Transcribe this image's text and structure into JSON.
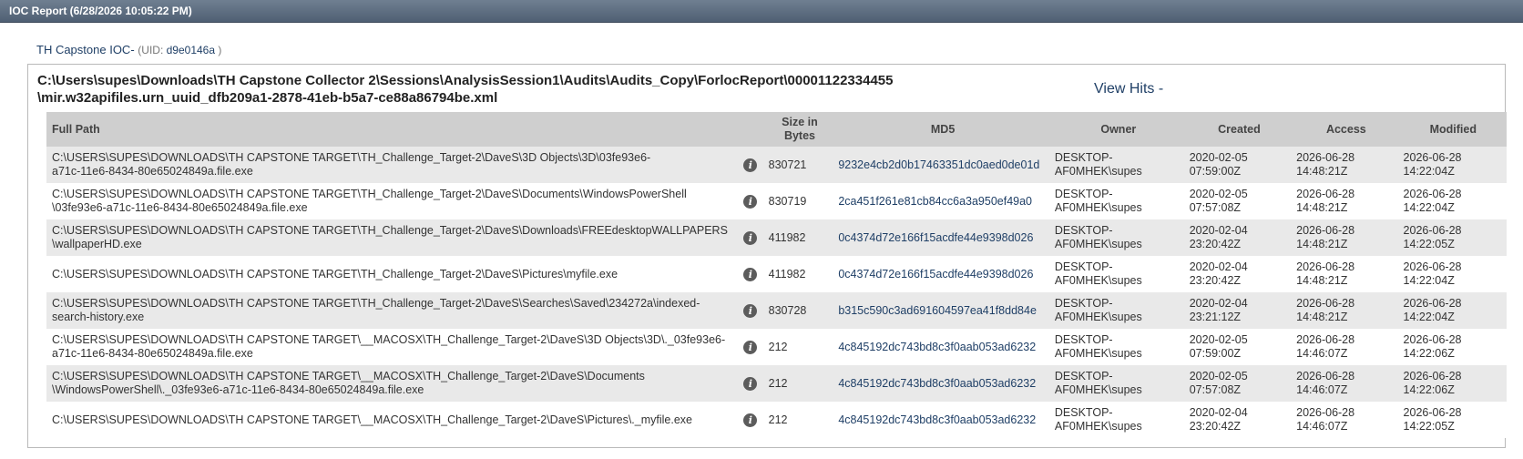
{
  "window": {
    "title": "IOC Report (6/28/2026 10:05:22 PM)"
  },
  "ioc": {
    "name": "TH Capstone IOC-",
    "uid_label": "(UID:",
    "uid": "d9e0146a",
    "uid_close": ")"
  },
  "panel": {
    "path_line1": "C:\\Users\\supes\\Downloads\\TH Capstone Collector 2\\Sessions\\AnalysisSession1\\Audits\\Audits_Copy\\ForlocReport\\00001122334455",
    "path_line2": "\\mir.w32apifiles.urn_uuid_dfb209a1-2878-41eb-b5a7-ce88a86794be.xml",
    "view_hits": "View Hits -"
  },
  "table": {
    "headers": {
      "full_path": "Full Path",
      "size_line1": "Size in",
      "size_line2": "Bytes",
      "md5": "MD5",
      "owner": "Owner",
      "created": "Created",
      "access": "Access",
      "modified": "Modified"
    },
    "rows": [
      {
        "path1": "C:\\USERS\\SUPES\\DOWNLOADS\\TH CAPSTONE TARGET\\TH_Challenge_Target-2\\DaveS\\3D Objects\\3D\\03fe93e6-",
        "path2": "a71c-11e6-8434-80e65024849a.file.exe",
        "size": "830721",
        "md5": "9232e4cb2d0b17463351dc0aed0de01d",
        "owner1": "DESKTOP-",
        "owner2": "AF0MHEK\\supes",
        "created1": "2020-02-05",
        "created2": "07:59:00Z",
        "access1": "2026-06-28",
        "access2": "14:48:21Z",
        "modified1": "2026-06-28",
        "modified2": "14:22:04Z"
      },
      {
        "path1": "C:\\USERS\\SUPES\\DOWNLOADS\\TH CAPSTONE TARGET\\TH_Challenge_Target-2\\DaveS\\Documents\\WindowsPowerShell",
        "path2": "\\03fe93e6-a71c-11e6-8434-80e65024849a.file.exe",
        "size": "830719",
        "md5": "2ca451f261e81cb84cc6a3a950ef49a0",
        "owner1": "DESKTOP-",
        "owner2": "AF0MHEK\\supes",
        "created1": "2020-02-05",
        "created2": "07:57:08Z",
        "access1": "2026-06-28",
        "access2": "14:48:21Z",
        "modified1": "2026-06-28",
        "modified2": "14:22:04Z"
      },
      {
        "path1": "C:\\USERS\\SUPES\\DOWNLOADS\\TH CAPSTONE TARGET\\TH_Challenge_Target-2\\DaveS\\Downloads\\FREEdesktopWALLPAPERS",
        "path2": "\\wallpaperHD.exe",
        "size": "411982",
        "md5": "0c4374d72e166f15acdfe44e9398d026",
        "owner1": "DESKTOP-",
        "owner2": "AF0MHEK\\supes",
        "created1": "2020-02-04",
        "created2": "23:20:42Z",
        "access1": "2026-06-28",
        "access2": "14:48:21Z",
        "modified1": "2026-06-28",
        "modified2": "14:22:05Z"
      },
      {
        "path1": "C:\\USERS\\SUPES\\DOWNLOADS\\TH CAPSTONE TARGET\\TH_Challenge_Target-2\\DaveS\\Pictures\\myfile.exe",
        "path2": "",
        "size": "411982",
        "md5": "0c4374d72e166f15acdfe44e9398d026",
        "owner1": "DESKTOP-",
        "owner2": "AF0MHEK\\supes",
        "created1": "2020-02-04",
        "created2": "23:20:42Z",
        "access1": "2026-06-28",
        "access2": "14:48:21Z",
        "modified1": "2026-06-28",
        "modified2": "14:22:04Z"
      },
      {
        "path1": "C:\\USERS\\SUPES\\DOWNLOADS\\TH CAPSTONE TARGET\\TH_Challenge_Target-2\\DaveS\\Searches\\Saved\\234272a\\indexed-",
        "path2": "search-history.exe",
        "size": "830728",
        "md5": "b315c590c3ad691604597ea41f8dd84e",
        "owner1": "DESKTOP-",
        "owner2": "AF0MHEK\\supes",
        "created1": "2020-02-04",
        "created2": "23:21:12Z",
        "access1": "2026-06-28",
        "access2": "14:48:21Z",
        "modified1": "2026-06-28",
        "modified2": "14:22:04Z"
      },
      {
        "path1": "C:\\USERS\\SUPES\\DOWNLOADS\\TH CAPSTONE TARGET\\__MACOSX\\TH_Challenge_Target-2\\DaveS\\3D Objects\\3D\\._03fe93e6-",
        "path2": "a71c-11e6-8434-80e65024849a.file.exe",
        "size": "212",
        "md5": "4c845192dc743bd8c3f0aab053ad6232",
        "owner1": "DESKTOP-",
        "owner2": "AF0MHEK\\supes",
        "created1": "2020-02-05",
        "created2": "07:59:00Z",
        "access1": "2026-06-28",
        "access2": "14:46:07Z",
        "modified1": "2026-06-28",
        "modified2": "14:22:06Z"
      },
      {
        "path1": "C:\\USERS\\SUPES\\DOWNLOADS\\TH CAPSTONE TARGET\\__MACOSX\\TH_Challenge_Target-2\\DaveS\\Documents",
        "path2": "\\WindowsPowerShell\\._03fe93e6-a71c-11e6-8434-80e65024849a.file.exe",
        "size": "212",
        "md5": "4c845192dc743bd8c3f0aab053ad6232",
        "owner1": "DESKTOP-",
        "owner2": "AF0MHEK\\supes",
        "created1": "2020-02-05",
        "created2": "07:57:08Z",
        "access1": "2026-06-28",
        "access2": "14:46:07Z",
        "modified1": "2026-06-28",
        "modified2": "14:22:06Z"
      },
      {
        "path1": "C:\\USERS\\SUPES\\DOWNLOADS\\TH CAPSTONE TARGET\\__MACOSX\\TH_Challenge_Target-2\\DaveS\\Pictures\\._myfile.exe",
        "path2": "",
        "size": "212",
        "md5": "4c845192dc743bd8c3f0aab053ad6232",
        "owner1": "DESKTOP-",
        "owner2": "AF0MHEK\\supes",
        "created1": "2020-02-04",
        "created2": "23:20:42Z",
        "access1": "2026-06-28",
        "access2": "14:46:07Z",
        "modified1": "2026-06-28",
        "modified2": "14:22:05Z"
      }
    ]
  }
}
